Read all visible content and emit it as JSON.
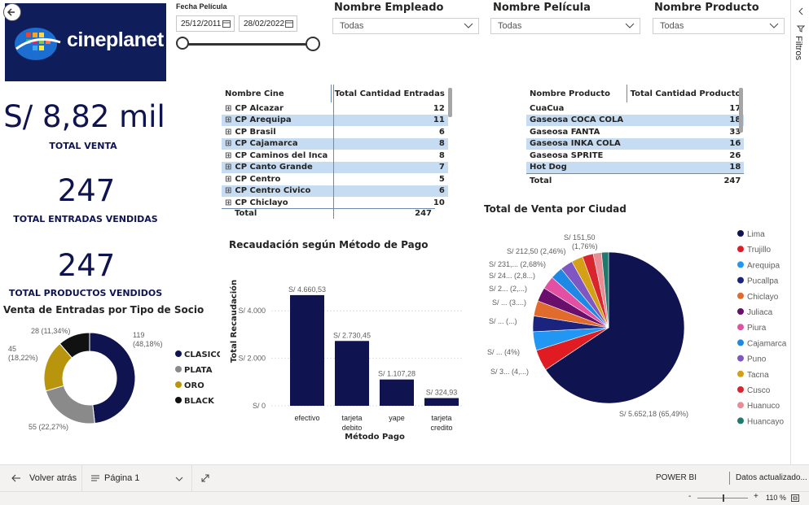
{
  "app": {
    "brand_text": "cineplanet"
  },
  "filters": {
    "fecha": {
      "label": "Fecha Película",
      "start": "25/12/2011",
      "end": "28/02/2022"
    },
    "empleado": {
      "label": "Nombre Empleado",
      "value": "Todas"
    },
    "pelicula": {
      "label": "Nombre Película",
      "value": "Todas"
    },
    "producto": {
      "label": "Nombre Producto",
      "value": "Todas"
    },
    "pane_label": "Filtros"
  },
  "kpis": {
    "venta": {
      "value": "S/ 8,82 mil",
      "label": "TOTAL VENTA"
    },
    "entradas": {
      "value": "247",
      "label": "TOTAL ENTRADAS VENDIDAS"
    },
    "productos": {
      "value": "247",
      "label": "TOTAL PRODUCTOS VENDIDOS"
    }
  },
  "cine_table": {
    "headers": [
      "Nombre Cine",
      "Total Cantidad Entradas"
    ],
    "rows": [
      [
        "CP Alcazar",
        "12"
      ],
      [
        "CP Arequipa",
        "11"
      ],
      [
        "CP Brasil",
        "6"
      ],
      [
        "CP Cajamarca",
        "8"
      ],
      [
        "CP Caminos del Inca",
        "8"
      ],
      [
        "CP Canto Grande",
        "7"
      ],
      [
        "CP Centro",
        "5"
      ],
      [
        "CP Centro Civico",
        "6"
      ],
      [
        "CP Chiclayo",
        "10"
      ]
    ],
    "total_label": "Total",
    "total_value": "247"
  },
  "producto_table": {
    "headers": [
      "Nombre Producto",
      "Total Cantidad Producto"
    ],
    "rows": [
      [
        "CuaCua",
        "17"
      ],
      [
        "Gaseosa COCA COLA",
        "18"
      ],
      [
        "Gaseosa FANTA",
        "33"
      ],
      [
        "Gaseosa INKA COLA",
        "16"
      ],
      [
        "Gaseosa SPRITE",
        "26"
      ],
      [
        "Hot Dog",
        "18"
      ]
    ],
    "total_label": "Total",
    "total_value": "247"
  },
  "bottom": {
    "back_label": "Volver atrás",
    "page_label": "Página 1",
    "powerbi_label": "POWER BI",
    "updated_label": "Datos actualizado...",
    "zoom": "110 %"
  },
  "chart_data": [
    {
      "type": "donut",
      "title": "Venta de Entradas por Tipo de Socio",
      "categories": [
        "CLASICO",
        "PLATA",
        "ORO",
        "BLACK"
      ],
      "values": [
        119,
        55,
        45,
        28
      ],
      "data_labels": [
        "119 (48,18%)",
        "55 (22,27%)",
        "45 (18,22%)",
        "28 (11,34%)"
      ],
      "colors": [
        "#0f1450",
        "#8a8a8a",
        "#b8950c",
        "#111111"
      ],
      "legend_position": "right"
    },
    {
      "type": "bar",
      "title": "Recaudación según Método de Pago",
      "categories": [
        "efectivo",
        "tarjeta debito",
        "yape",
        "tarjeta credito"
      ],
      "values": [
        4660.53,
        2730.45,
        1107.28,
        324.93
      ],
      "data_labels": [
        "S/ 4.660,53",
        "S/ 2.730,45",
        "S/ 1.107,28",
        "S/ 324,93"
      ],
      "xlabel": "Método Pago",
      "ylabel": "Total Recaudación",
      "yticks": [
        "S/ 0",
        "S/ 2.000",
        "S/ 4.000"
      ],
      "ylim": [
        0,
        5000
      ],
      "color": "#0f1450",
      "grid": true
    },
    {
      "type": "pie",
      "title": "Total de Venta por Ciudad",
      "categories": [
        "Lima",
        "Trujillo",
        "Arequipa",
        "Pucallpa",
        "Chiclayo",
        "Juliaca",
        "Piura",
        "Cajamarca",
        "Puno",
        "Tacna",
        "Cusco",
        "Huanuco",
        "Huancayo"
      ],
      "values": [
        5652.18,
        390,
        345,
        290,
        280,
        260,
        240,
        230,
        232,
        212.5,
        200,
        151.5,
        130
      ],
      "colors": [
        "#0f1450",
        "#e11b22",
        "#2196f3",
        "#1a237e",
        "#e06b2c",
        "#6a0f6b",
        "#e34fa3",
        "#1e88e5",
        "#7e57c2",
        "#d4a017",
        "#d8262f",
        "#e88c95",
        "#1f7a6d"
      ],
      "data_labels": [
        "S/ 5.652,18 (65,49%)",
        "S/ 3... (4,...)",
        "S/ ... (4%)",
        "S/ ... (...)",
        "S/ ... (3....)",
        "S/ 2... (2,...)",
        "S/ 24... (2,8...)",
        "S/ 231,... (2,68%)",
        "S/ 212,50 (2,46%)",
        "S/ 151,50 (1,76%)"
      ],
      "legend_position": "right"
    }
  ]
}
